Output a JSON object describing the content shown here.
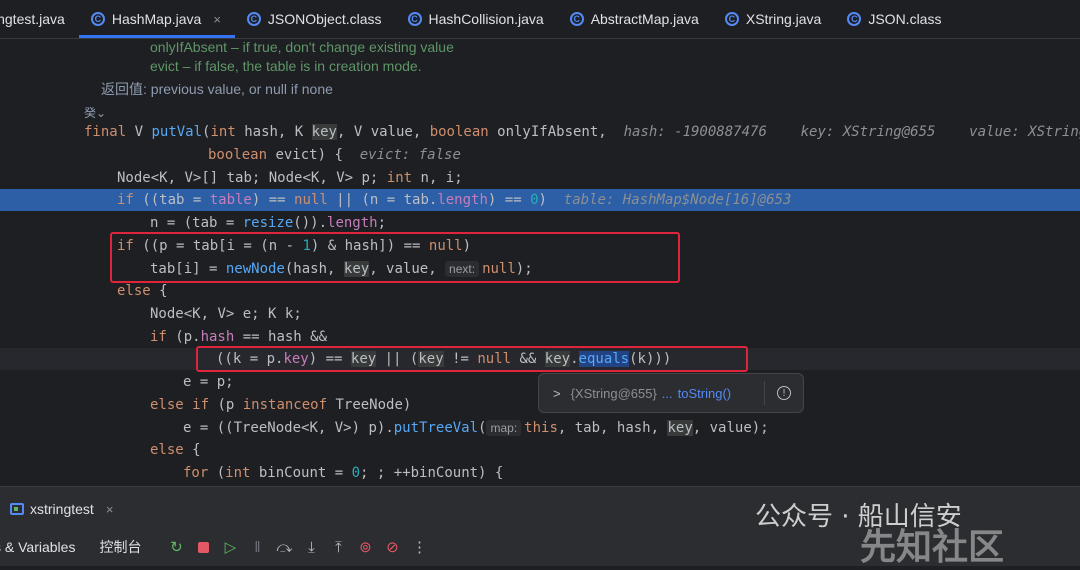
{
  "tabs": [
    {
      "label": "ingtest.java",
      "icon": "java-class-icon"
    },
    {
      "label": "HashMap.java",
      "icon": "java-class-icon",
      "active": true,
      "close": "×"
    },
    {
      "label": "JSONObject.class",
      "icon": "java-class-icon"
    },
    {
      "label": "HashCollision.java",
      "icon": "java-class-icon"
    },
    {
      "label": "AbstractMap.java",
      "icon": "java-class-icon"
    },
    {
      "label": "XString.java",
      "icon": "java-class-icon"
    },
    {
      "label": "JSON.class",
      "icon": "java-class-icon"
    }
  ],
  "doc": {
    "param1": "onlyIfAbsent – if true, don't change existing value",
    "param2": "evict – if false, the table is in creation mode.",
    "returns": "返回值: previous value, or null if none",
    "fold": "癸⌄"
  },
  "inline_values": {
    "hash": "hash: -1900887476",
    "key": "key: XString@655",
    "value": "value: XString@",
    "evict": "evict: false",
    "table": "table: HashMap$Node[16]@653"
  },
  "hints": {
    "next": "next:",
    "map": "map:"
  },
  "popup": {
    "chevron": ">",
    "object": "{XString@655}",
    "ellipsis": "...",
    "link": "toString()",
    "info": "!"
  },
  "debug": {
    "tab_label": "xstringtest",
    "tab_close": "×",
    "vars_label": "s & Variables",
    "console_label": "控制台"
  },
  "watermark": {
    "text": "公众号 · 船山信安",
    "text2": "先知社区"
  },
  "colors": {
    "background": "#1e1f22",
    "execution_line": "#2c5fa6",
    "highlight_box": "#e0243c",
    "accent": "#3574f0"
  }
}
